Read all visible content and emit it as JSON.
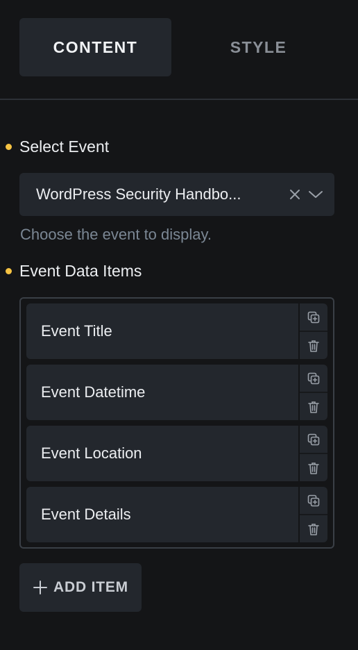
{
  "tabs": [
    {
      "label": "CONTENT",
      "active": true
    },
    {
      "label": "STYLE",
      "active": false
    }
  ],
  "select_event": {
    "label": "Select Event",
    "value": "WordPress Security Handbo...",
    "help": "Choose the event to display."
  },
  "event_items": {
    "label": "Event Data Items",
    "items": [
      {
        "label": "Event Title"
      },
      {
        "label": "Event Datetime"
      },
      {
        "label": "Event Location"
      },
      {
        "label": "Event Details"
      }
    ],
    "add_label": "ADD ITEM"
  },
  "colors": {
    "background": "#141517",
    "panel": "#23272d",
    "accent_dot": "#f6c343",
    "help_text": "#7b8794"
  },
  "icons": {
    "clear": "close-icon",
    "dropdown": "chevron-down-icon",
    "duplicate": "duplicate-icon",
    "delete": "trash-icon",
    "add": "plus-icon"
  }
}
